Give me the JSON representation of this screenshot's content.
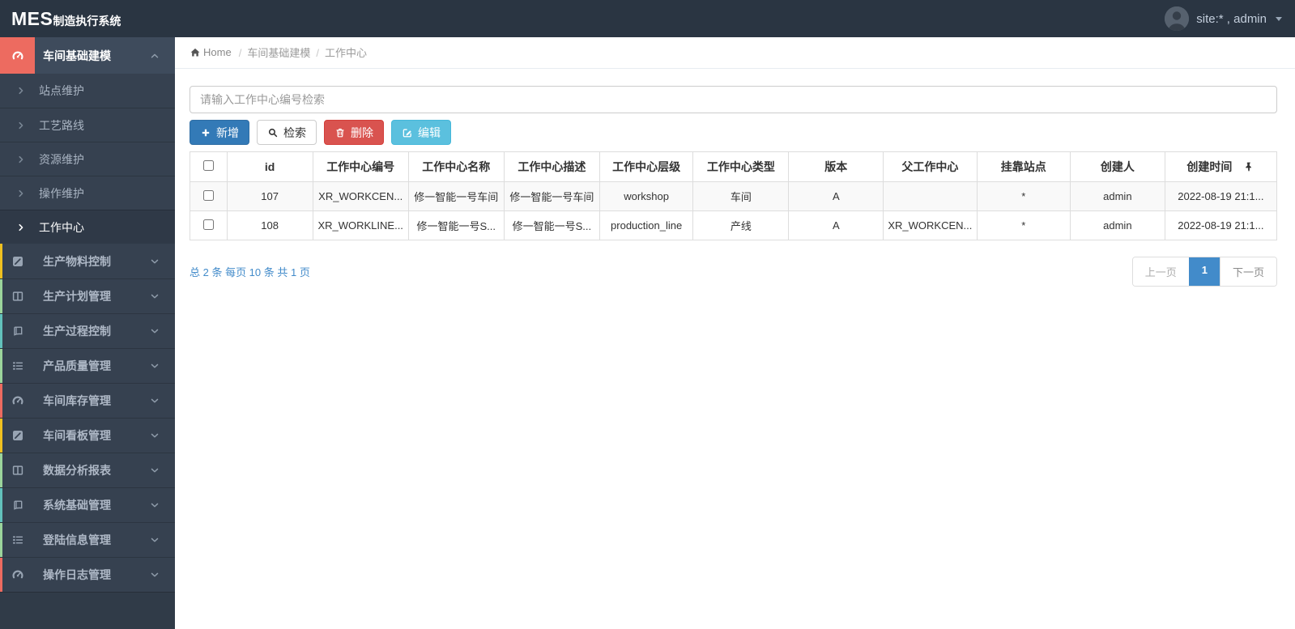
{
  "topbar": {
    "logo_primary": "MES",
    "logo_secondary": "制造执行系统",
    "user_label": "site:* , admin"
  },
  "sidebar": {
    "active_group": {
      "label": "车间基础建模",
      "icon": "dashboard-icon",
      "icon_bg": "#ED6B60"
    },
    "submenu": [
      {
        "label": "站点维护",
        "active": false
      },
      {
        "label": "工艺路线",
        "active": false
      },
      {
        "label": "资源维护",
        "active": false
      },
      {
        "label": "操作维护",
        "active": false
      },
      {
        "label": "工作中心",
        "active": true
      }
    ],
    "groups": [
      {
        "label": "生产物料控制",
        "icon": "pencil-icon",
        "stripe": "#EFC020"
      },
      {
        "label": "生产计划管理",
        "icon": "columns-icon",
        "stripe": "#9BD49B"
      },
      {
        "label": "生产过程控制",
        "icon": "book-icon",
        "stripe": "#62C1BC"
      },
      {
        "label": "产品质量管理",
        "icon": "list-icon",
        "stripe": "#9BD49B"
      },
      {
        "label": "车间库存管理",
        "icon": "dashboard-icon",
        "stripe": "#ED6B60"
      },
      {
        "label": "车间看板管理",
        "icon": "pencil-icon",
        "stripe": "#EFC020"
      },
      {
        "label": "数据分析报表",
        "icon": "columns-icon",
        "stripe": "#9BD49B"
      },
      {
        "label": "系统基础管理",
        "icon": "book-icon",
        "stripe": "#62C1BC"
      },
      {
        "label": "登陆信息管理",
        "icon": "list-icon",
        "stripe": "#9BD49B"
      },
      {
        "label": "操作日志管理",
        "icon": "dashboard-icon",
        "stripe": "#ED6B60"
      }
    ]
  },
  "breadcrumb": {
    "home": "Home",
    "items": [
      "车间基础建模",
      "工作中心"
    ]
  },
  "toolbar": {
    "search_placeholder": "请输入工作中心编号检索",
    "buttons": [
      {
        "label": "新增",
        "icon": "plus-icon",
        "style": "primary"
      },
      {
        "label": "检索",
        "icon": "search-icon",
        "style": "default"
      },
      {
        "label": "删除",
        "icon": "trash-icon",
        "style": "danger"
      },
      {
        "label": "编辑",
        "icon": "edit-icon",
        "style": "info"
      }
    ]
  },
  "table": {
    "columns": [
      "id",
      "工作中心编号",
      "工作中心名称",
      "工作中心描述",
      "工作中心层级",
      "工作中心类型",
      "版本",
      "父工作中心",
      "挂靠站点",
      "创建人",
      "创建时间"
    ],
    "col_widths_pct": [
      3.4,
      7.9,
      8.8,
      8.8,
      8.8,
      8.6,
      8.8,
      8.7,
      8.6,
      8.6,
      8.7,
      10.3
    ],
    "rows": [
      [
        "107",
        "XR_WORKCEN...",
        "修一智能一号车间",
        "修一智能一号车间",
        "workshop",
        "车间",
        "A",
        "",
        "*",
        "admin",
        "2022-08-19 21:1..."
      ],
      [
        "108",
        "XR_WORKLINE...",
        "修一智能一号S...",
        "修一智能一号S...",
        "production_line",
        "产线",
        "A",
        "XR_WORKCEN...",
        "*",
        "admin",
        "2022-08-19 21:1..."
      ]
    ]
  },
  "pagination": {
    "summary": "总 2 条 每页 10 条 共 1 页",
    "prev_label": "上一页",
    "current_page": "1",
    "next_label": "下一页"
  },
  "colors": {
    "topbar_bg": "#2A3542",
    "sidebar_bg": "#364150",
    "active_icon_bg": "#ED6B60",
    "primary": "#337AB7",
    "danger": "#D9534F",
    "info": "#5BC0DE",
    "link_blue": "#428BCA",
    "stripe_yellow": "#EFC020",
    "stripe_green": "#9BD49B",
    "stripe_teal": "#62C1BC"
  }
}
